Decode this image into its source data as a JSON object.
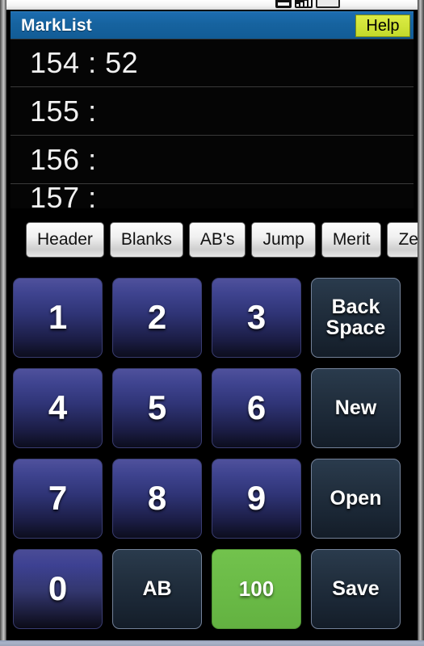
{
  "status_bar": {
    "icons": [
      "signal-icon",
      "signal-bars-icon",
      "battery-icon"
    ]
  },
  "title_bar": {
    "app_title": "MarkList",
    "help_label": "Help",
    "bg_color": "#16639f",
    "help_bg_color": "#cfe337"
  },
  "list": {
    "rows": [
      {
        "label": "154 : 52"
      },
      {
        "label": "155 :"
      },
      {
        "label": "156 :"
      },
      {
        "label": "157 :"
      }
    ]
  },
  "toolbar": {
    "buttons": [
      {
        "label": "Header"
      },
      {
        "label": "Blanks"
      },
      {
        "label": "AB's"
      },
      {
        "label": "Jump"
      },
      {
        "label": "Merit"
      },
      {
        "label": "Zer"
      }
    ]
  },
  "keypad": {
    "rows": [
      [
        {
          "label": "1",
          "style": "num"
        },
        {
          "label": "2",
          "style": "num"
        },
        {
          "label": "3",
          "style": "num"
        },
        {
          "label": "Back\nSpace",
          "style": "fn"
        }
      ],
      [
        {
          "label": "4",
          "style": "num"
        },
        {
          "label": "5",
          "style": "num"
        },
        {
          "label": "6",
          "style": "num"
        },
        {
          "label": "New",
          "style": "fn"
        }
      ],
      [
        {
          "label": "7",
          "style": "num"
        },
        {
          "label": "8",
          "style": "num"
        },
        {
          "label": "9",
          "style": "num"
        },
        {
          "label": "Open",
          "style": "fn"
        }
      ],
      [
        {
          "label": "0",
          "style": "zero"
        },
        {
          "label": "AB",
          "style": "fn"
        },
        {
          "label": "100",
          "style": "green"
        },
        {
          "label": "Save",
          "style": "fn"
        }
      ]
    ],
    "key_colors": {
      "number": "#33376f",
      "function": "#22303f",
      "hundred": "#6bbb47"
    }
  }
}
